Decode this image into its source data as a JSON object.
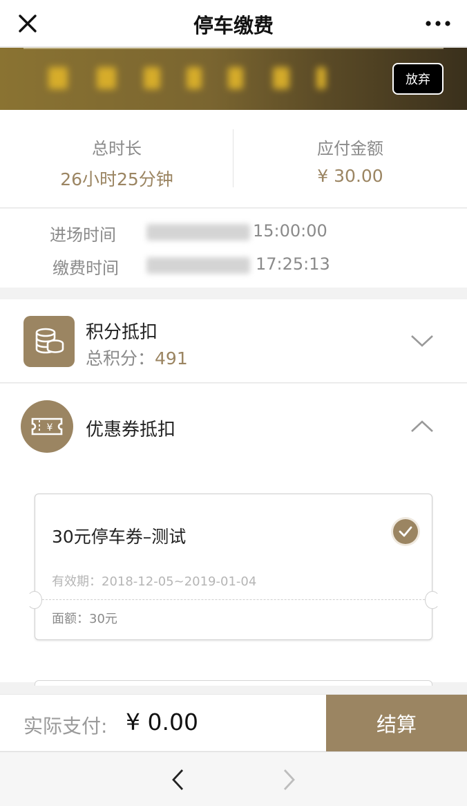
{
  "nav": {
    "title": "停车缴费",
    "close_icon": "close-icon",
    "more_icon": "more-icon"
  },
  "plate": {
    "abandon_label": "放弃",
    "colors": {
      "banner": "#7a6530",
      "plate_text": "#e0b42a"
    }
  },
  "summary": {
    "duration_label": "总时长",
    "duration_value": "26小时25分钟",
    "amount_label": "应付金额",
    "amount_value": "¥ 30.00"
  },
  "times": {
    "entry_label": "进场时间",
    "entry_value": "15:00:00",
    "pay_label": "缴费时间",
    "pay_value": "17:25:13"
  },
  "points": {
    "title": "积分抵扣",
    "total_label": "总积分：",
    "total_value": "491",
    "icon": "coins-icon",
    "expanded": false
  },
  "coupons": {
    "title": "优惠券抵扣",
    "icon": "ticket-icon",
    "expanded": true,
    "items": [
      {
        "name": "30元停车券–测试",
        "validity": "有效期：2018-12-05~2019-01-04",
        "face_value": "面额：30元",
        "selected": true
      }
    ]
  },
  "payment": {
    "label": "实际支付:",
    "amount": "¥  0.00",
    "settle_label": "结算"
  },
  "colors": {
    "accent": "#9b8562",
    "muted_text": "#8a8a8a"
  }
}
